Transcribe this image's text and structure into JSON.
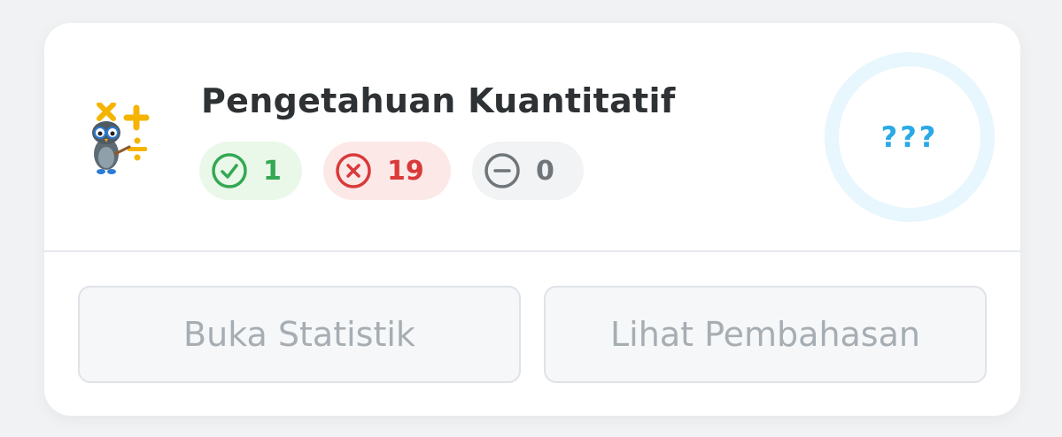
{
  "subject": {
    "title": "Pengetahuan Kuantitatif",
    "mascot_icon": "owl-math-icon"
  },
  "stats": {
    "correct": "1",
    "wrong": "19",
    "blank": "0"
  },
  "score": {
    "value": "???"
  },
  "actions": {
    "stats_label": "Buka Statistik",
    "review_label": "Lihat Pembahasan",
    "disabled": true
  },
  "colors": {
    "correct": "#34a853",
    "wrong": "#d93a3a",
    "blank": "#6f7579",
    "score": "#2aa9e6",
    "ring": "#e8f6fd"
  }
}
